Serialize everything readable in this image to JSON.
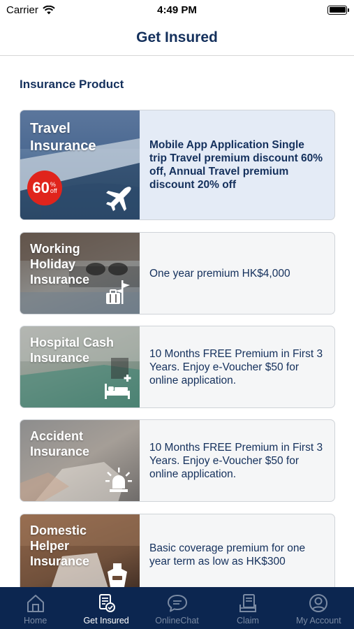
{
  "status_bar": {
    "carrier": "Carrier",
    "time": "4:49 PM"
  },
  "header": {
    "title": "Get Insured"
  },
  "section": {
    "title": "Insurance Product"
  },
  "products": [
    {
      "title": "Travel\nInsurance",
      "icon": "airplane-icon",
      "description": "Mobile App Application Single trip Travel premium discount 60% off, Annual Travel premium discount 20% off",
      "badge": {
        "value": "60",
        "percent": "%",
        "off": "off"
      }
    },
    {
      "title": "Working\nHoliday\nInsurance",
      "icon": "luggage-signpost-icon",
      "description": "One year premium HK$4,000"
    },
    {
      "title": "Hospital Cash\nInsurance",
      "icon": "hospital-bed-icon",
      "description": "10 Months FREE Premium in First 3 Years. Enjoy e-Voucher $50 for online application."
    },
    {
      "title": "Accident\nInsurance",
      "icon": "siren-icon",
      "description": "10 Months FREE Premium in First 3 Years. Enjoy e-Voucher $50 for online application."
    },
    {
      "title": "Domestic\nHelper\nInsurance",
      "icon": "apron-icon",
      "description": "Basic coverage premium for one year term as low as HK$300"
    }
  ],
  "tabs": [
    {
      "label": "Home",
      "icon": "home-icon",
      "active": false
    },
    {
      "label": "Get Insured",
      "icon": "document-check-icon",
      "active": true
    },
    {
      "label": "OnlineChat",
      "icon": "chat-bubble-icon",
      "active": false
    },
    {
      "label": "Claim",
      "icon": "claim-form-icon",
      "active": false
    },
    {
      "label": "My Account",
      "icon": "user-circle-icon",
      "active": false
    }
  ],
  "colors": {
    "navy": "#14305c",
    "tab_bar": "#0c2650",
    "badge_red": "#e0241c",
    "highlight_card": "#e4ebf6"
  }
}
